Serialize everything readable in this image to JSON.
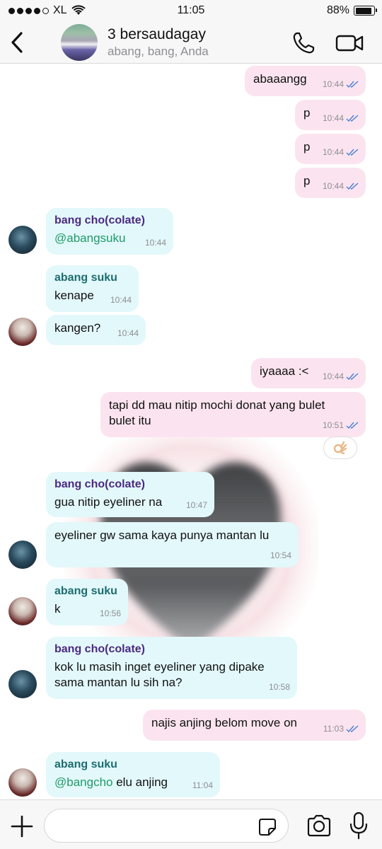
{
  "status_bar": {
    "carrier": "XL",
    "time": "11:05",
    "battery": "88%",
    "battery_level": 0.88
  },
  "header": {
    "title": "3 bersaudagay",
    "subtitle": "abang, bang, Anda"
  },
  "messages": [
    {
      "text": "abaaangg",
      "time": "10:44"
    },
    {
      "text": "p",
      "time": "10:44"
    },
    {
      "text": "p",
      "time": "10:44"
    },
    {
      "text": "p",
      "time": "10:44"
    },
    {
      "sender": "bang cho(colate)",
      "mention": "@abangsuku",
      "text": "",
      "time": "10:44"
    },
    {
      "sender": "abang suku",
      "text": "kenape",
      "time": "10:44"
    },
    {
      "text": "kangen?",
      "time": "10:44"
    },
    {
      "text": "iyaaaa :<",
      "time": "10:44"
    },
    {
      "text_line1": "tapi dd mau nitip mochi donat yang bulet",
      "text_line2": "bulet itu",
      "time": "10:51"
    },
    {
      "sender": "bang cho(colate)",
      "text": "gua nitip eyeliner na",
      "time": "10:47"
    },
    {
      "text": "eyeliner gw sama kaya punya mantan lu",
      "time": "10:54"
    },
    {
      "sender": "abang suku",
      "text": "k",
      "time": "10:56"
    },
    {
      "sender": "bang cho(colate)",
      "text_line1": "kok lu masih inget eyeliner yang dipake",
      "text_line2": "sama mantan lu sih na?",
      "time": "10:58"
    },
    {
      "text": "najis anjing belom move on",
      "time": "11:03"
    },
    {
      "sender": "abang suku",
      "mention": "@bangcho",
      "text": " elu anjing",
      "time": "11:04"
    }
  ],
  "reaction": {
    "emoji_name": "ok-hand-icon"
  },
  "input": {
    "placeholder": ""
  },
  "colors": {
    "outgoing_bubble": "#fbe4ef",
    "incoming_bubble": "#e3f8fb",
    "read_ticks": "#4a7fd6",
    "mention": "#1f9b67"
  }
}
